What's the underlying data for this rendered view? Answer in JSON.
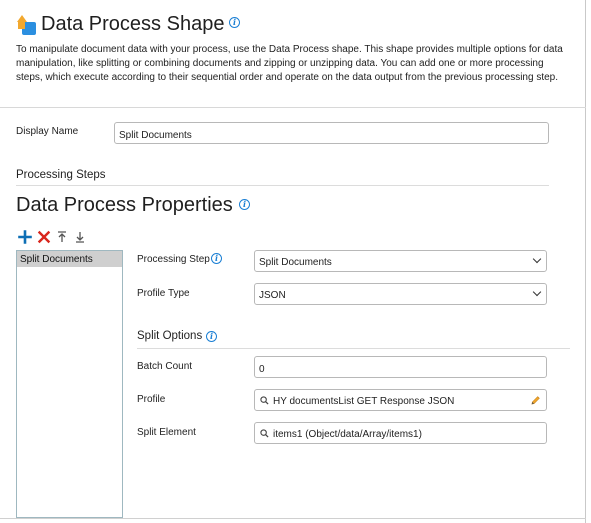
{
  "header": {
    "title": "Data Process Shape",
    "description": "To manipulate document data with your process, use the Data Process shape. This shape provides multiple options for data manipulation, like splitting or combining documents and zipping or unzipping data. You can add one or more processing steps, which execute according to their sequential order and operate on the data output from the previous processing step."
  },
  "display_name": {
    "label": "Display Name",
    "value": "Split Documents"
  },
  "processing_steps": {
    "heading": "Processing Steps"
  },
  "properties": {
    "title": "Data Process Properties",
    "toolbar": [
      "add-icon",
      "delete-icon",
      "move-up-icon",
      "move-down-icon"
    ],
    "steps_list": [
      "Split Documents"
    ],
    "processing_step": {
      "label": "Processing Step",
      "value": "Split Documents"
    },
    "profile_type": {
      "label": "Profile Type",
      "value": "JSON"
    },
    "split_options": {
      "heading": "Split Options",
      "batch_count": {
        "label": "Batch Count",
        "value": "0"
      },
      "profile": {
        "label": "Profile",
        "value": "HY documentsList GET Response JSON"
      },
      "split_element": {
        "label": "Split Element",
        "value": "items1 (Object/data/Array/items1)"
      }
    }
  },
  "colors": {
    "accent_blue": "#1a7fd4",
    "add_green": "#0e6fb5",
    "delete_red": "#d9261c",
    "shape_orange": "#f2a82e"
  }
}
